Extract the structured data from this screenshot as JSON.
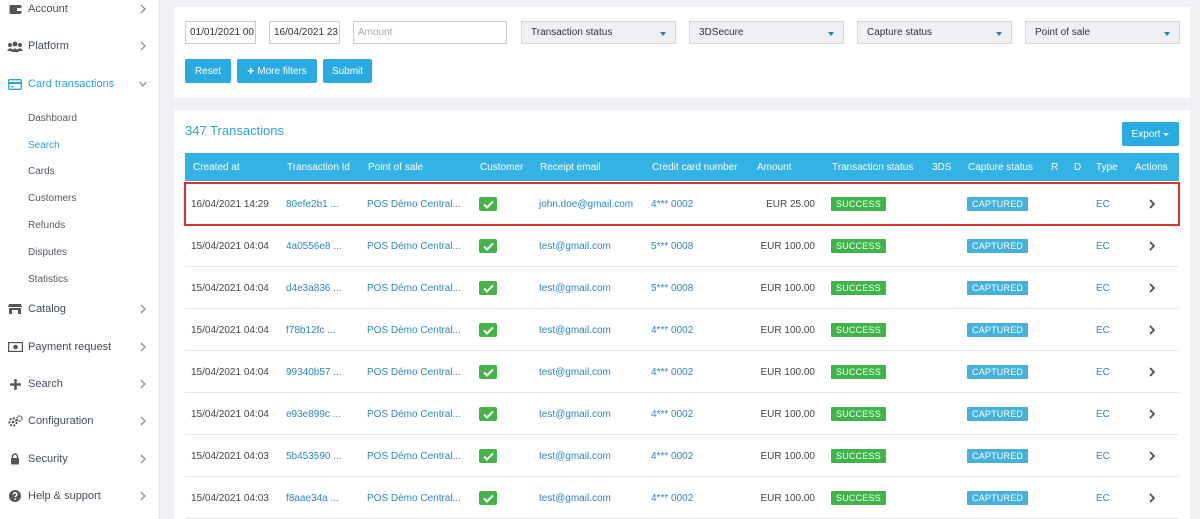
{
  "sidebar": {
    "items": [
      {
        "label": "Account",
        "icon": "wallet-icon"
      },
      {
        "label": "Platform",
        "icon": "users-icon"
      },
      {
        "label": "Card transactions",
        "icon": "credit-card-icon"
      },
      {
        "label": "Catalog",
        "icon": "store-icon"
      },
      {
        "label": "Payment request",
        "icon": "banknote-icon"
      },
      {
        "label": "Search",
        "icon": "plus-icon"
      },
      {
        "label": "Configuration",
        "icon": "gears-icon"
      },
      {
        "label": "Security",
        "icon": "lock-icon"
      },
      {
        "label": "Help & support",
        "icon": "question-icon"
      }
    ],
    "sub_items": [
      "Dashboard",
      "Search",
      "Cards",
      "Customers",
      "Refunds",
      "Disputes",
      "Statistics"
    ]
  },
  "filters": {
    "date_from": "01/01/2021 00:",
    "date_to": "16/04/2021 23:",
    "amount_placeholder": "Amount",
    "selects": [
      "Transaction status",
      "3DSecure",
      "Capture status",
      "Point of sale"
    ],
    "buttons": {
      "reset": "Reset",
      "more_filters": "More filters",
      "submit": "Submit"
    }
  },
  "transactions": {
    "title": "347 Transactions",
    "export_label": "Export",
    "columns": [
      "Created at",
      "Transaction Id",
      "Point of sale",
      "Customer",
      "Receipt email",
      "Credit card number",
      "Amount",
      "Transaction status",
      "3DS",
      "Capture status",
      "R",
      "D",
      "Type",
      "Actions"
    ],
    "rows": [
      {
        "created": "16/04/2021 14:29",
        "id": "80efe2b1 ...",
        "pos": "POS Démo Central...",
        "email": "john.doe@gmail.com",
        "card": "4*** 0002",
        "amount": "EUR 25.00",
        "status": "SUCCESS",
        "capture": "CAPTURED",
        "type": "EC"
      },
      {
        "created": "15/04/2021 04:04",
        "id": "4a0556e8 ...",
        "pos": "POS Démo Central...",
        "email": "test@gmail.com",
        "card": "5*** 0008",
        "amount": "EUR 100.00",
        "status": "SUCCESS",
        "capture": "CAPTURED",
        "type": "EC"
      },
      {
        "created": "15/04/2021 04:04",
        "id": "d4e3a836 ...",
        "pos": "POS Démo Central...",
        "email": "test@gmail.com",
        "card": "5*** 0008",
        "amount": "EUR 100.00",
        "status": "SUCCESS",
        "capture": "CAPTURED",
        "type": "EC"
      },
      {
        "created": "15/04/2021 04:04",
        "id": "f78b12fc ...",
        "pos": "POS Démo Central...",
        "email": "test@gmail.com",
        "card": "4*** 0002",
        "amount": "EUR 100.00",
        "status": "SUCCESS",
        "capture": "CAPTURED",
        "type": "EC"
      },
      {
        "created": "15/04/2021 04:04",
        "id": "99340b57 ...",
        "pos": "POS Démo Central...",
        "email": "test@gmail.com",
        "card": "4*** 0002",
        "amount": "EUR 100.00",
        "status": "SUCCESS",
        "capture": "CAPTURED",
        "type": "EC"
      },
      {
        "created": "15/04/2021 04:04",
        "id": "e93e899c ...",
        "pos": "POS Démo Central...",
        "email": "test@gmail.com",
        "card": "4*** 0002",
        "amount": "EUR 100.00",
        "status": "SUCCESS",
        "capture": "CAPTURED",
        "type": "EC"
      },
      {
        "created": "15/04/2021 04:03",
        "id": "5b453590 ...",
        "pos": "POS Démo Central...",
        "email": "test@gmail.com",
        "card": "4*** 0002",
        "amount": "EUR 100.00",
        "status": "SUCCESS",
        "capture": "CAPTURED",
        "type": "EC"
      },
      {
        "created": "15/04/2021 04:03",
        "id": "f8aae34a ...",
        "pos": "POS Démo Central...",
        "email": "test@gmail.com",
        "card": "4*** 0002",
        "amount": "EUR 100.00",
        "status": "SUCCESS",
        "capture": "CAPTURED",
        "type": "EC"
      }
    ]
  },
  "colors": {
    "accent": "#29abe2",
    "header": "#33b2e5",
    "success": "#3fb44a",
    "captured": "#46b1d9",
    "highlight": "#d9342b"
  }
}
